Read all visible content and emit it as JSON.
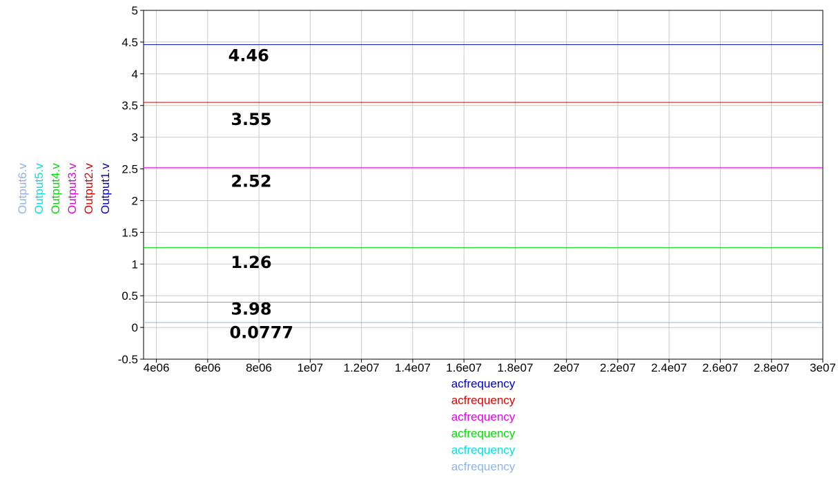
{
  "chart_data": {
    "type": "line",
    "xlim": [
      3500000,
      30000000
    ],
    "ylim": [
      -0.5,
      5
    ],
    "grid": true,
    "x_ticks": [
      {
        "value": 4000000,
        "label": "4e06"
      },
      {
        "value": 6000000,
        "label": "6e06"
      },
      {
        "value": 8000000,
        "label": "8e06"
      },
      {
        "value": 10000000,
        "label": "1e07"
      },
      {
        "value": 12000000,
        "label": "1.2e07"
      },
      {
        "value": 14000000,
        "label": "1.4e07"
      },
      {
        "value": 16000000,
        "label": "1.6e07"
      },
      {
        "value": 18000000,
        "label": "1.8e07"
      },
      {
        "value": 20000000,
        "label": "2e07"
      },
      {
        "value": 22000000,
        "label": "2.2e07"
      },
      {
        "value": 24000000,
        "label": "2.4e07"
      },
      {
        "value": 26000000,
        "label": "2.6e07"
      },
      {
        "value": 28000000,
        "label": "2.8e07"
      },
      {
        "value": 30000000,
        "label": "3e07"
      }
    ],
    "y_ticks": [
      {
        "value": -0.5,
        "label": "-0.5"
      },
      {
        "value": 0,
        "label": "0"
      },
      {
        "value": 0.5,
        "label": "0.5"
      },
      {
        "value": 1,
        "label": "1"
      },
      {
        "value": 1.5,
        "label": "1.5"
      },
      {
        "value": 2,
        "label": "2"
      },
      {
        "value": 2.5,
        "label": "2.5"
      },
      {
        "value": 3,
        "label": "3"
      },
      {
        "value": 3.5,
        "label": "3.5"
      },
      {
        "value": 4,
        "label": "4"
      },
      {
        "value": 4.5,
        "label": "4.5"
      },
      {
        "value": 5,
        "label": "5"
      }
    ],
    "series": [
      {
        "name": "Output1.v",
        "color": "#0000c8",
        "x": [
          3500000,
          30000000
        ],
        "y": [
          4.46,
          4.46
        ]
      },
      {
        "name": "Output2.v",
        "color": "#e00000",
        "x": [
          3500000,
          30000000
        ],
        "y": [
          3.55,
          3.55
        ]
      },
      {
        "name": "Output3.v",
        "color": "#e000e0",
        "x": [
          3500000,
          30000000
        ],
        "y": [
          2.52,
          2.52
        ]
      },
      {
        "name": "Output4.v",
        "color": "#00dc00",
        "x": [
          3500000,
          30000000
        ],
        "y": [
          1.26,
          1.26
        ]
      },
      {
        "name": "Output5.v",
        "color": "#00e0e0",
        "x": [
          3500000,
          30000000
        ],
        "y": [
          0.398,
          0.398
        ]
      },
      {
        "name": "Output6.v",
        "color": "#8fb4e8",
        "x": [
          3500000,
          30000000
        ],
        "y": [
          0.0777,
          0.0777
        ]
      }
    ],
    "x_axis_labels": [
      {
        "text": "acfrequency",
        "color": "#0000c8"
      },
      {
        "text": "acfrequency",
        "color": "#e00000"
      },
      {
        "text": "acfrequency",
        "color": "#e000e0"
      },
      {
        "text": "acfrequency",
        "color": "#00dc00"
      },
      {
        "text": "acfrequency",
        "color": "#00e0e0"
      },
      {
        "text": "acfrequency",
        "color": "#8fb4e8"
      }
    ],
    "annotations": [
      {
        "text": "4.46",
        "x": 7600000,
        "y": 4.2
      },
      {
        "text": "3.55",
        "x": 7700000,
        "y": 3.19
      },
      {
        "text": "2.52",
        "x": 7700000,
        "y": 2.22
      },
      {
        "text": "1.26",
        "x": 7700000,
        "y": 0.94
      },
      {
        "text": "3.98",
        "x": 7700000,
        "y": 0.2
      },
      {
        "text": "0.0777",
        "x": 8100000,
        "y": -0.17
      }
    ]
  }
}
